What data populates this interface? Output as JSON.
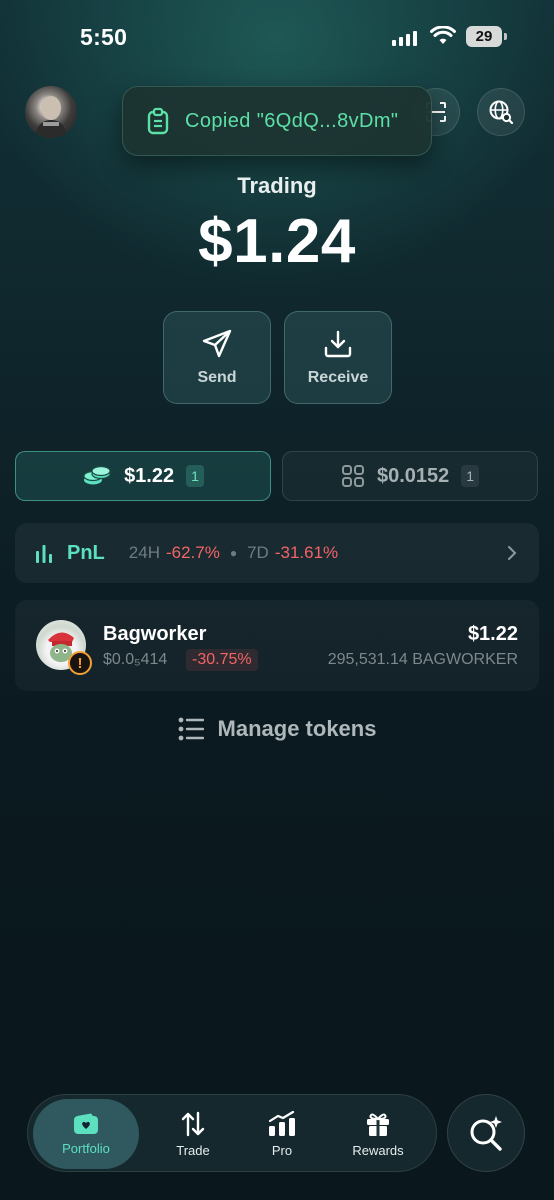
{
  "status_bar": {
    "time": "5:50",
    "battery": "29"
  },
  "header": {
    "toast_text": "Copied \"6QdQ...8vDm\"",
    "icons": [
      "avatar",
      "scan-icon",
      "globe-search-icon"
    ]
  },
  "wallet": {
    "label": "Trading",
    "balance": "$1.24"
  },
  "actions": {
    "send": "Send",
    "receive": "Receive"
  },
  "tabs": {
    "tokens": {
      "amount": "$1.22",
      "count": "1"
    },
    "collectibles": {
      "amount": "$0.0152",
      "count": "1"
    }
  },
  "pnl": {
    "title": "PnL",
    "period_24h": "24H",
    "change_24h": "-62.7%",
    "period_7d": "7D",
    "change_7d": "-31.61%"
  },
  "tokens": [
    {
      "name": "Bagworker",
      "price": "$0.0₅414",
      "change": "-30.75%",
      "value": "$1.22",
      "amount": "295,531.14 BAGWORKER"
    }
  ],
  "manage_label": "Manage tokens",
  "nav": {
    "portfolio": "Portfolio",
    "trade": "Trade",
    "pro": "Pro",
    "rewards": "Rewards"
  },
  "colors": {
    "accent": "#5ce0c0",
    "negative": "#f26466",
    "warning": "#f2a03a"
  }
}
